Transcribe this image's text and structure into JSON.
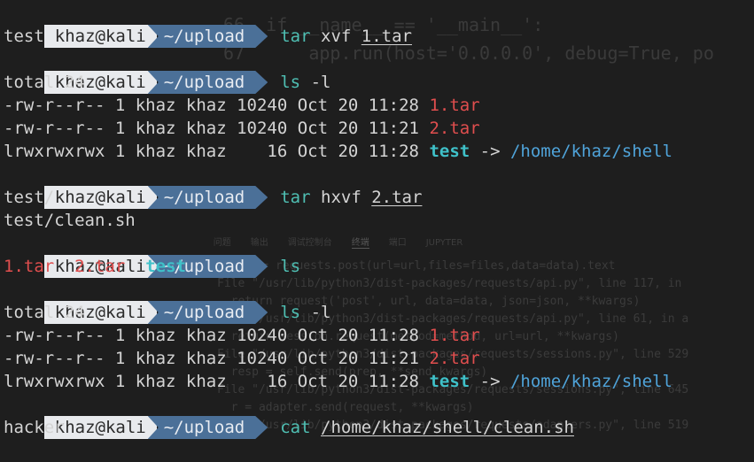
{
  "prompt": {
    "user": "khaz@kali",
    "dir": "~/upload"
  },
  "background_editor": {
    "code_lines": [
      "66  if __name__ == '__main__':",
      "67      app.run(host='0.0.0.0', debug=True, po"
    ],
    "panel_tabs": [
      "问题",
      "输出",
      "调试控制台",
      "终端",
      "端口",
      "JUPYTER"
    ],
    "traceback_lines": [
      "res = requests.post(url=url,files=files,data=data).text",
      "File \"/usr/lib/python3/dist-packages/requests/api.py\", line 117, in",
      "  return request('post', url, data=data, json=json, **kwargs)",
      "File \"/usr/lib/python3/dist-packages/requests/api.py\", line 61, in a",
      "  return session.request(method=method, url=url, **kwargs)",
      "File \"/usr/lib/python3/dist-packages/requests/sessions.py\", line 529",
      "  resp = self.send(prep, **send_kwargs)",
      "File \"/usr/lib/python3/dist-packages/requests/sessions.py\", line 645",
      "  r = adapter.send(request, **kwargs)",
      "File \"/usr/lib/python3/dist-packages/requests/adapters.py\", line 519"
    ]
  },
  "terminal": {
    "cmd1": {
      "name": "tar",
      "args": "xvf",
      "file": "1.tar"
    },
    "out1": "test",
    "cmd2": {
      "name": "ls",
      "args": "-l"
    },
    "out2_total": "total 24",
    "out2_rows": [
      {
        "text": "-rw-r--r-- 1 khaz khaz 10240 Oct 20 11:28 ",
        "name": "1.tar"
      },
      {
        "text": "-rw-r--r-- 1 khaz khaz 10240 Oct 20 11:21 ",
        "name": "2.tar"
      },
      {
        "text": "lrwxrwxrwx 1 khaz khaz    16 Oct 20 11:28 ",
        "name": "test",
        "arrow": " -> ",
        "target": "/home/khaz/shell"
      }
    ],
    "cmd3": {
      "name": "tar",
      "args": "hxvf",
      "file": "2.tar"
    },
    "out3": [
      "test/",
      "test/clean.sh"
    ],
    "cmd4": {
      "name": "ls"
    },
    "out4": {
      "a": "1.tar",
      "b": "2.tar",
      "c": "test"
    },
    "cmd5": {
      "name": "ls",
      "args": "-l"
    },
    "out5_total": "total 24",
    "out5_rows": [
      {
        "text": "-rw-r--r-- 1 khaz khaz 10240 Oct 20 11:28 ",
        "name": "1.tar"
      },
      {
        "text": "-rw-r--r-- 1 khaz khaz 10240 Oct 20 11:21 ",
        "name": "2.tar"
      },
      {
        "text": "lrwxrwxrwx 1 khaz khaz    16 Oct 20 11:28 ",
        "name": "test",
        "arrow": " -> ",
        "target": "/home/khaz/shell"
      }
    ],
    "cmd6": {
      "name": "cat",
      "file": "/home/khaz/shell/clean.sh"
    },
    "out6": "hacker"
  },
  "colors": {
    "background": "#1e1e1e",
    "prompt_user_bg": "#e8eaed",
    "prompt_dir_bg": "#4b7098",
    "command": "#4fbfb3",
    "archive_file": "#e04e4e",
    "directory": "#3fc1c9",
    "link_target": "#4fa3d9"
  }
}
